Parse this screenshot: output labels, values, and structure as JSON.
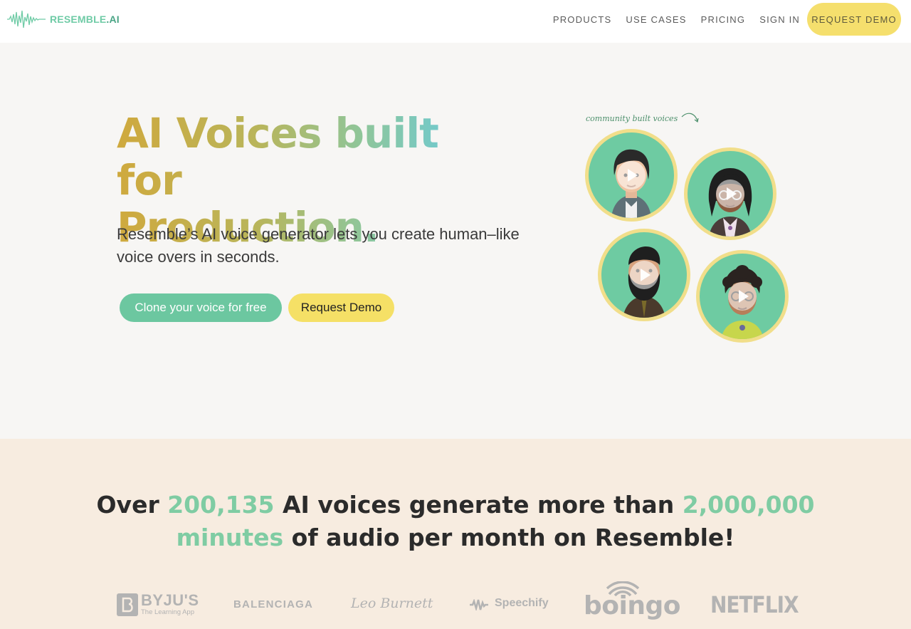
{
  "nav": {
    "logo": {
      "name": "RESEMBLE",
      "suffix": ".AI"
    },
    "links": [
      "PRODUCTS",
      "USE CASES",
      "PRICING",
      "SIGN IN"
    ],
    "cta": "REQUEST DEMO"
  },
  "hero": {
    "headline_line1": "AI Voices built for",
    "headline_line2": "Production.",
    "subtext": "Resemble’s AI voice generator lets you create human–like voice overs in seconds.",
    "btn_clone": "Clone your voice for free",
    "btn_demo": "Request Demo",
    "community_label": "community built voices"
  },
  "stats": {
    "part1": "Over ",
    "voices_count": "200,135",
    "part2": " AI voices generate more than ",
    "minutes_count": "2,000,000",
    "minutes_word": "minutes",
    "part3": " of audio per month on Resemble!"
  },
  "logos": {
    "byjus": {
      "name": "BYJU'S",
      "tagline": "The Learning App"
    },
    "balenciaga": "BALENCIAGA",
    "leo_burnett": "Leo Burnett",
    "speechify": "Speechify",
    "boingo": "boingo",
    "netflix": "NETFLIX"
  },
  "colors": {
    "accent_green": "#6cc7a0",
    "accent_yellow": "#f5e066",
    "stats_highlight": "#7fcca3"
  }
}
